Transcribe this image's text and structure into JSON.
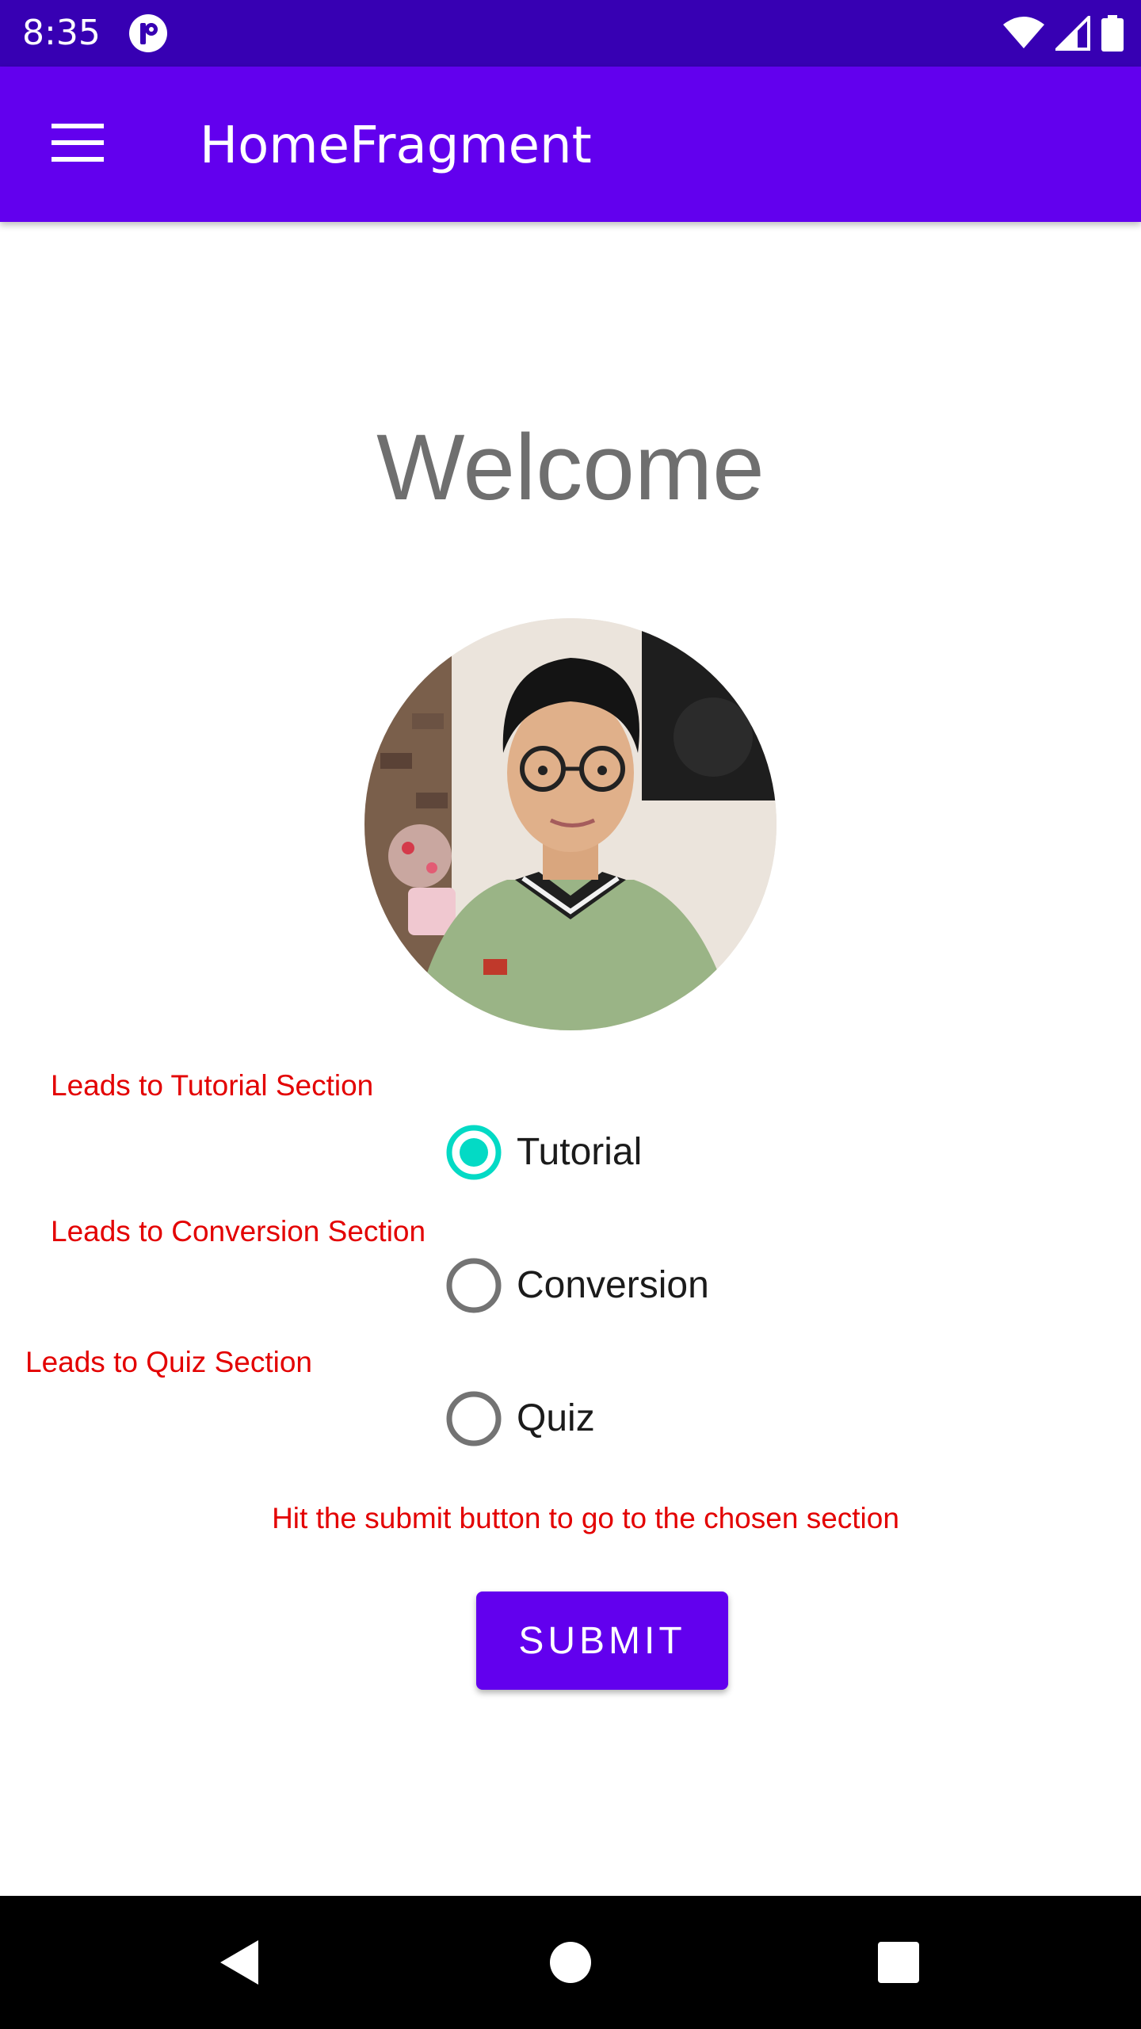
{
  "status_bar": {
    "time": "8:35",
    "icons": [
      "notification-app-icon",
      "wifi-icon",
      "cellular-signal-icon",
      "battery-icon"
    ]
  },
  "app_bar": {
    "title": "HomeFragment",
    "menu_icon": "hamburger-menu-icon"
  },
  "main": {
    "welcome": "Welcome",
    "avatar_alt": "profile-photo",
    "options": [
      {
        "hint": "Leads to Tutorial Section",
        "label": "Tutorial",
        "selected": true
      },
      {
        "hint": "Leads to Conversion Section",
        "label": "Conversion",
        "selected": false
      },
      {
        "hint": "Leads to Quiz Section",
        "label": "Quiz",
        "selected": false
      }
    ],
    "submit_hint": "Hit the submit button to go to the chosen section",
    "submit_label": "SUBMIT"
  },
  "nav_bar": {
    "icons": [
      "back-icon",
      "home-icon",
      "recents-icon"
    ]
  },
  "colors": {
    "status_bar": "#3700b3",
    "primary": "#6200ee",
    "accent": "#03dac5",
    "hint_text": "#e30000"
  }
}
